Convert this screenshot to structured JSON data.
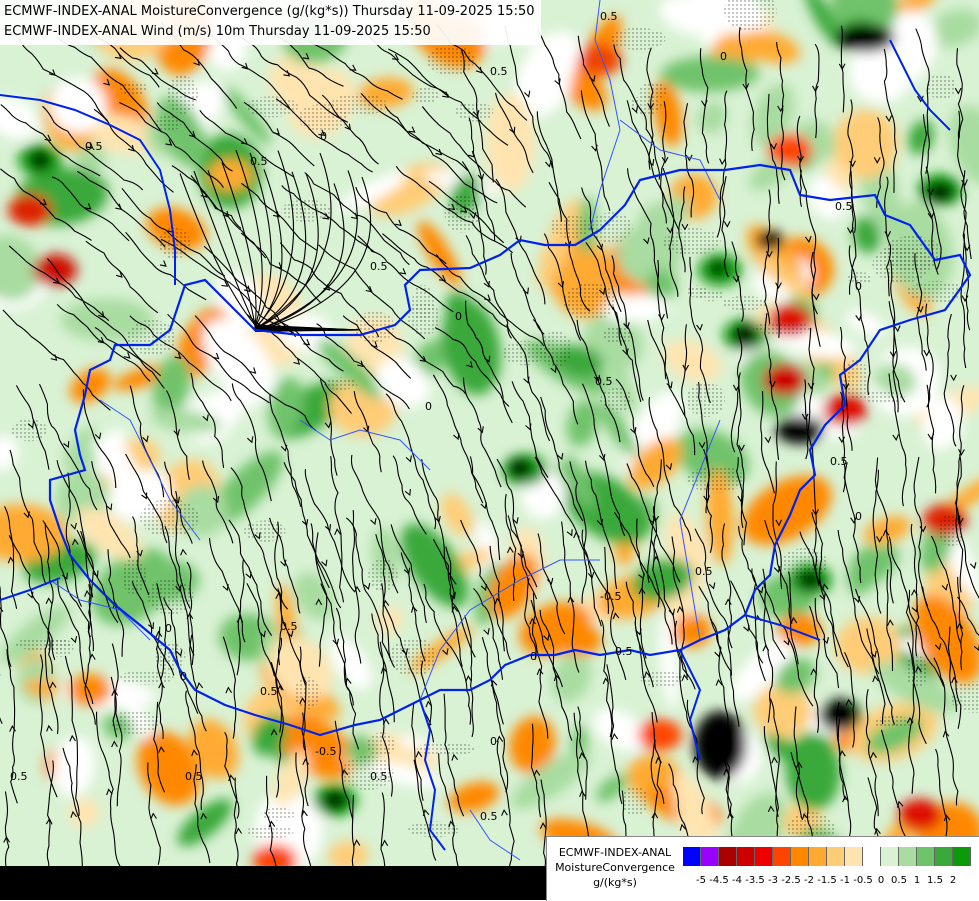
{
  "header": {
    "line1": "ECMWF-INDEX-ANAL MoistureConvergence (g/(kg*s)) Thursday 11-09-2025 15:50",
    "line2": "ECMWF-INDEX-ANAL Wind (m/s) 10m Thursday 11-09-2025 15:50"
  },
  "legend": {
    "source": "ECMWF-INDEX-ANAL",
    "parameter": "MoistureConvergence",
    "unit": "g/(kg*s)",
    "swatches": [
      "#0000ff",
      "#9900ff",
      "#aa0000",
      "#cc0000",
      "#ee0000",
      "#ff4400",
      "#ff8800",
      "#ffaa33",
      "#ffcc77",
      "#ffe4b0",
      "#ffffff",
      "#d9f2d4",
      "#a8dca0",
      "#6fc36a",
      "#3aa83a",
      "#0a9a0a"
    ],
    "ticks": [
      "-5",
      "-4.5",
      "-4",
      "-3.5",
      "-3",
      "-2.5",
      "-2",
      "-1.5",
      "-1",
      "-0.5",
      "0",
      "0.5",
      "1",
      "1.5",
      "2"
    ]
  },
  "contour_labels": [
    "0.5",
    "0",
    "0.5",
    "0.5",
    "0",
    "0.5",
    "0",
    "0.5",
    "0",
    "0.5",
    "0.5",
    "0",
    "-0.5",
    "0",
    "0.5",
    "0.5",
    "0",
    "0.5",
    "0",
    "0.5",
    "0.5",
    "0",
    "0.5",
    "-0.5",
    "0.5",
    "0",
    "0.5",
    "0.5"
  ],
  "colors": {
    "border": "#0022ee",
    "rivers": "#3355ff",
    "streamlines": "#000000"
  }
}
